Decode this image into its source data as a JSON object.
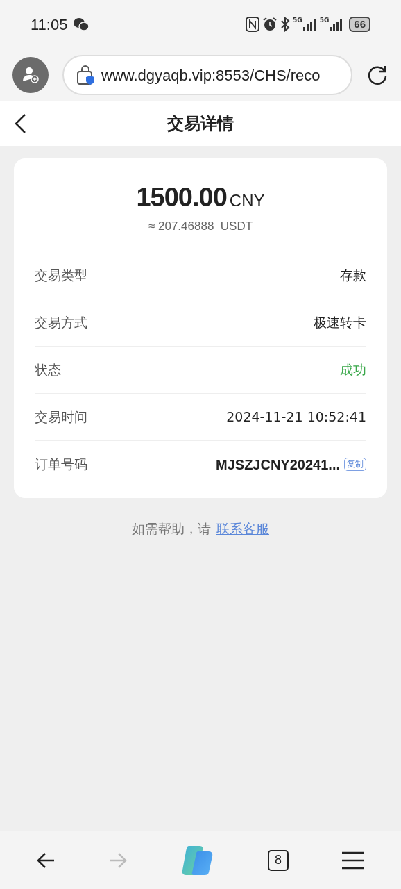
{
  "status_bar": {
    "time": "11:05",
    "signals": [
      {
        "label": "5G"
      },
      {
        "label": "5G"
      }
    ],
    "battery": "66"
  },
  "browser": {
    "url": "www.dgyaqb.vip:8553/CHS/reco"
  },
  "header": {
    "title": "交易详情"
  },
  "amount": {
    "value": "1500.00",
    "currency": "CNY",
    "converted": "≈ 207.46888  USDT"
  },
  "rows": [
    {
      "kind": "text",
      "label": "交易类型",
      "value": "存款"
    },
    {
      "kind": "text",
      "label": "交易方式",
      "value": "极速转卡"
    },
    {
      "kind": "status",
      "label": "状态",
      "value": "成功"
    },
    {
      "kind": "text",
      "label": "交易时间",
      "value": "2024-11-21 10:52:41"
    },
    {
      "kind": "order",
      "label": "订单号码",
      "value": "MJSZJCNY20241...",
      "action": "复制"
    }
  ],
  "help": {
    "text": "如需帮助，请",
    "link": "联系客服"
  },
  "bottom_bar": {
    "back_disabled": false,
    "forward_disabled": true,
    "tabs": "8"
  }
}
